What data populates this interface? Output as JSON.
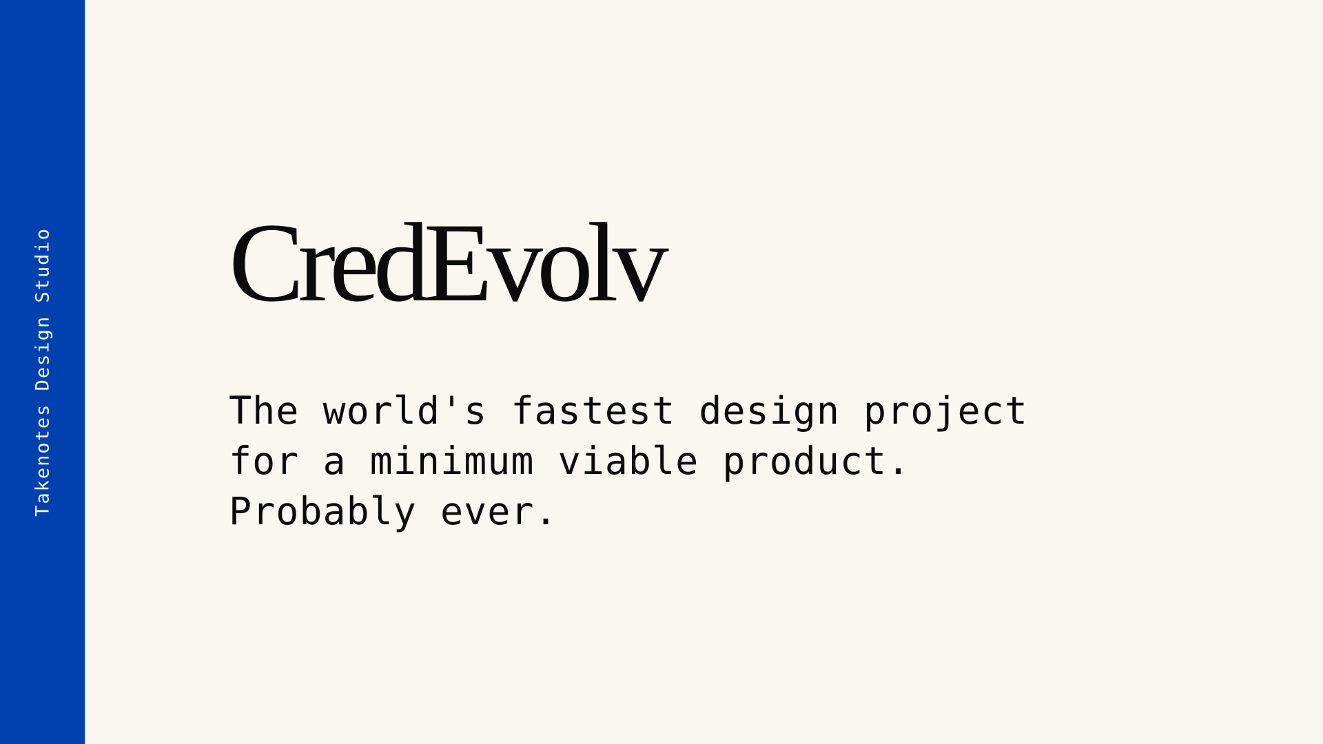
{
  "sidebar": {
    "label": "Takenotes Design Studio"
  },
  "main": {
    "title": "CredEvolv",
    "tagline_lines": [
      "The world's fastest design project",
      "for a minimum viable product.",
      "Probably ever."
    ]
  },
  "colors": {
    "sidebar_background": "#0041AF",
    "page_background": "#FAF6F0",
    "text": "#0B0B0B",
    "sidebar_text": "#FAF6F0"
  }
}
